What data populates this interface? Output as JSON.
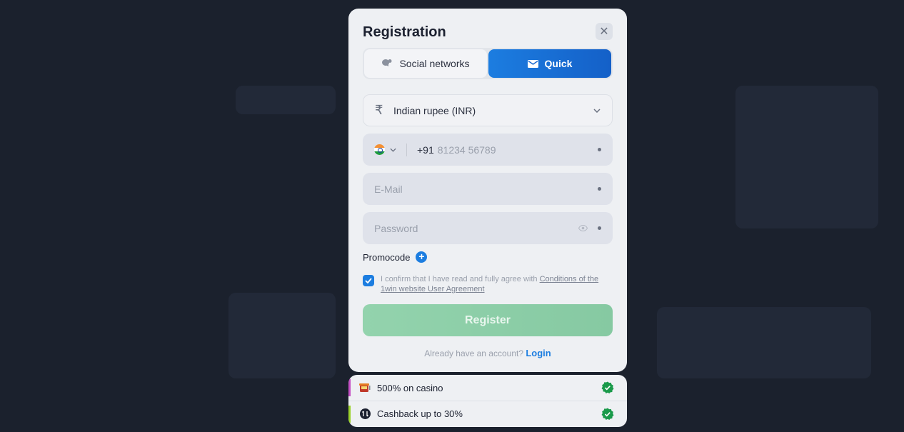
{
  "modal": {
    "title": "Registration",
    "close_icon": "close-icon",
    "tabs": [
      {
        "label": "Social networks",
        "icon": "chat-bubbles-icon",
        "active": false
      },
      {
        "label": "Quick",
        "icon": "envelope-icon",
        "active": true
      }
    ]
  },
  "form": {
    "currency": {
      "symbol": "₹",
      "value": "Indian rupee (INR)"
    },
    "phone": {
      "country_code": "+91",
      "placeholder": "81234 56789"
    },
    "email": {
      "placeholder": "E-Mail"
    },
    "password": {
      "placeholder": "Password"
    },
    "promocode_label": "Promocode",
    "consent_text": "I confirm that I have read and fully agree with",
    "consent_link": "Conditions of the 1win website User Agreement",
    "consent_checked": true,
    "register_label": "Register",
    "already_text": "Already have an account?",
    "login_label": "Login"
  },
  "bonuses": [
    {
      "label": "500% on casino",
      "icon": "slot-machine-icon",
      "accent": "#c44fc4"
    },
    {
      "label": "Cashback up to 30%",
      "icon": "cashback-icon",
      "accent": "#9bd22a"
    }
  ],
  "colors": {
    "accent_blue": "#1c7de0",
    "register_green": "#8ccfa7",
    "check_green": "#1a9a4a"
  }
}
